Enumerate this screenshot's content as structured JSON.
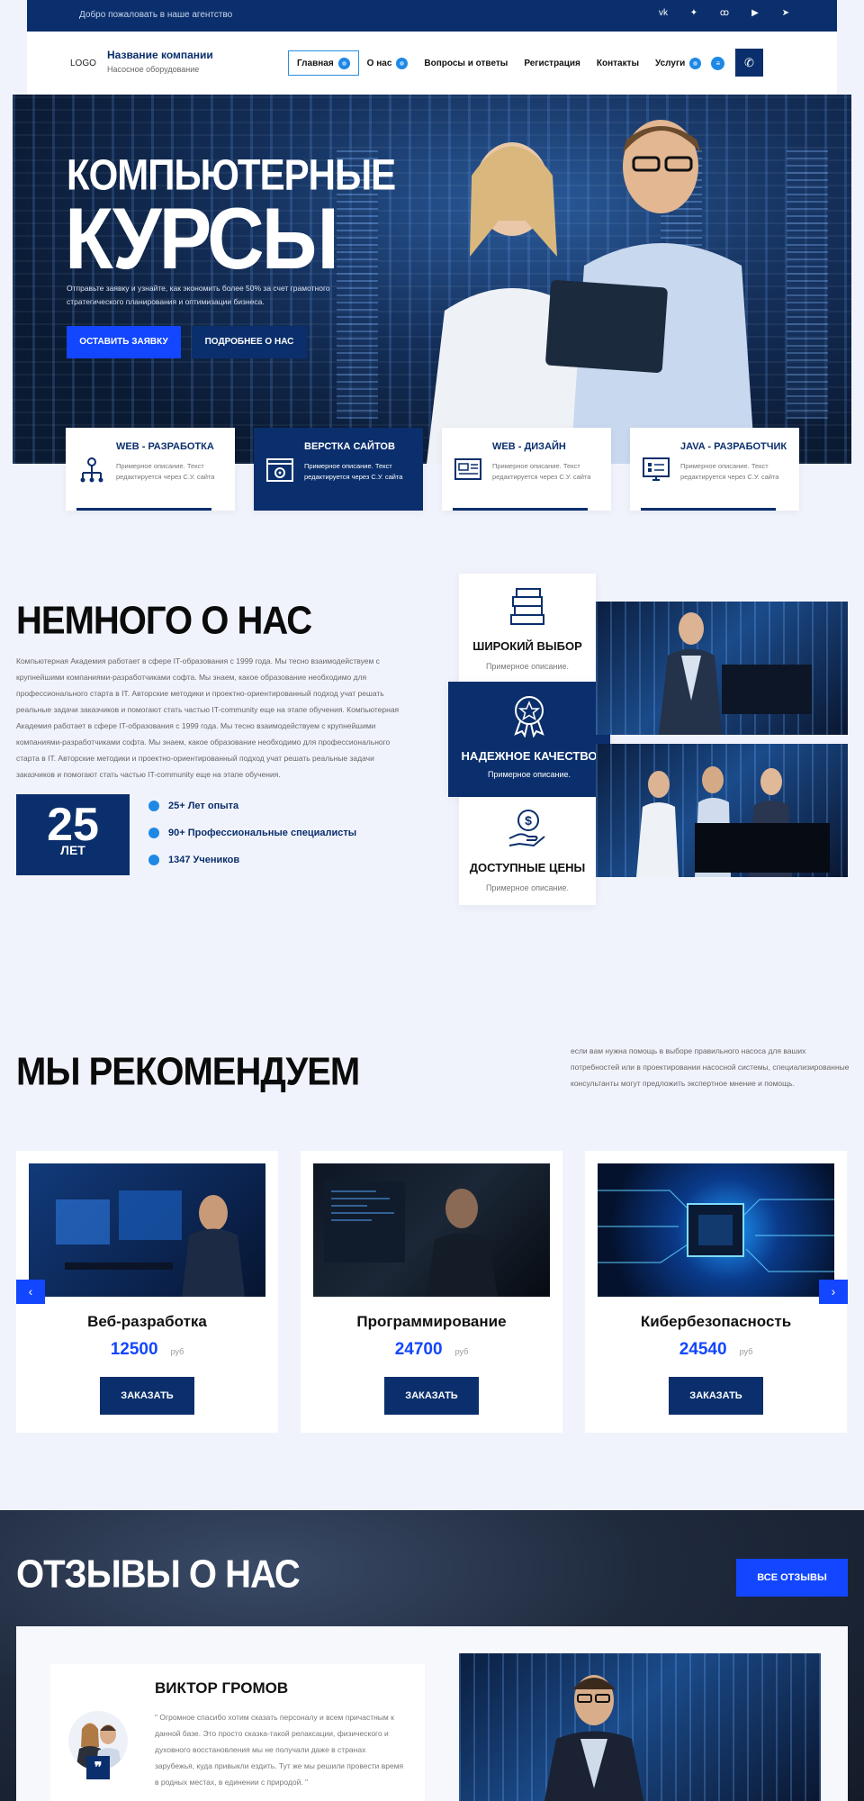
{
  "topbar": {
    "welcome": "Добро пожаловать в наше агентство",
    "socials": [
      {
        "name": "vk-icon",
        "glyph": "vk"
      },
      {
        "name": "twitter-icon",
        "glyph": "✦"
      },
      {
        "name": "odnoklassniki-icon",
        "glyph": "ꝏ"
      },
      {
        "name": "youtube-icon",
        "glyph": "▶"
      },
      {
        "name": "telegram-icon",
        "glyph": "➤"
      }
    ]
  },
  "header": {
    "logo": "LOGO",
    "company_name": "Название компании",
    "company_sub": "Насосное оборудование",
    "nav": {
      "home": "Главная",
      "about": "О нас",
      "faq": "Вопросы и ответы",
      "register": "Регистрация",
      "contacts": "Контакты",
      "services": "Услуги"
    },
    "phone_glyph": "✆"
  },
  "hero": {
    "title_line1": "КОМПЬЮТЕРНЫЕ",
    "title_line2": "КУРСЫ",
    "subtitle": "Отправьте заявку и узнайте, как экономить более 50% за счет грамотного стратегического планирования и оптимизации бизнеса.",
    "btn_primary": "ОСТАВИТЬ ЗАЯВКУ",
    "btn_secondary": "ПОДРОБНЕЕ О НАС"
  },
  "services": [
    {
      "title": "WEB - РАЗРАБОТКА",
      "desc": "Примерное описание. Текст редактируется через С.У. сайта"
    },
    {
      "title": "ВЕРСТКА САЙТОВ",
      "desc": "Примерное описание. Текст редактируется через С.У. сайта"
    },
    {
      "title": "WEB - ДИЗАЙН",
      "desc": "Примерное описание. Текст редактируется через С.У. сайта"
    },
    {
      "title": "JAVA - РАЗРАБОТЧИК",
      "desc": "Примерное описание. Текст редактируется через С.У. сайта"
    }
  ],
  "about": {
    "title": "НЕМНОГО О НАС",
    "text": "Компьютерная Академия работает в сфере IT-образования с 1999 года. Мы тесно взаимодействуем с крупнейшими компаниями-разработчиками софта. Мы знаем, какое образование необходимо для профессионального старта в IT. Авторские методики и проектно-ориентированный подход учат решать реальные задачи заказчиков и помогают стать частью IT-community еще на этапе обучения. Компьютерная Академия работает в сфере IT-образования с 1999 года. Мы тесно взаимодействуем с крупнейшими компаниями-разработчиками софта. Мы знаем, какое образование необходимо для профессионального старта в IT. Авторские методики и проектно-ориентированный подход учат решать реальные задачи заказчиков и помогают стать частью IT-community еще на этапе обучения.",
    "years_number": "25",
    "years_label": "ЛЕТ",
    "stats": [
      "25+ Лет опыта",
      "90+ Профессиональные специалисты",
      "1347 Учеников"
    ],
    "features": [
      {
        "title": "ШИРОКИЙ ВЫБОР",
        "desc": "Примерное описание."
      },
      {
        "title": "НАДЕЖНОЕ КАЧЕСТВО",
        "desc": "Примерное описание."
      },
      {
        "title": "ДОСТУПНЫЕ ЦЕНЫ",
        "desc": "Примерное описание."
      }
    ]
  },
  "recommend": {
    "title": "МЫ РЕКОМЕНДУЕМ",
    "text": "если вам нужна помощь в выборе правильного насоса для ваших потребностей или в проектировании насосной системы, специализированные консультанты могут предложить экспертное мнение и помощь.",
    "cards": [
      {
        "name": "Веб-разработка",
        "price": "12500",
        "currency": "руб",
        "button": "ЗАКАЗАТЬ"
      },
      {
        "name": "Программирование",
        "price": "24700",
        "currency": "руб",
        "button": "ЗАКАЗАТЬ"
      },
      {
        "name": "Кибербезопасность",
        "price": "24540",
        "currency": "руб",
        "button": "ЗАКАЗАТЬ"
      }
    ],
    "prev_glyph": "‹",
    "next_glyph": "›"
  },
  "reviews": {
    "title": "ОТЗЫВЫ О НАС",
    "all_button": "ВСЕ ОТЗЫВЫ",
    "name": "ВИКТОР ГРОМОВ",
    "text": "\" Огромное спасибо хотим сказать персоналу и всем причастным к данной базе. Это просто сказка-такой релаксации, физического и духовного восстановления мы не получали даже в странах зарубежья, куда привыкли ездить. Тут же мы решили провести время в родных местах, в единении с природой. \"",
    "quote_glyph": "❞"
  },
  "colors": {
    "primary": "#0a2f6c",
    "accent": "#1246ff",
    "dot": "#1e88e5",
    "background": "#f1f3fc"
  }
}
